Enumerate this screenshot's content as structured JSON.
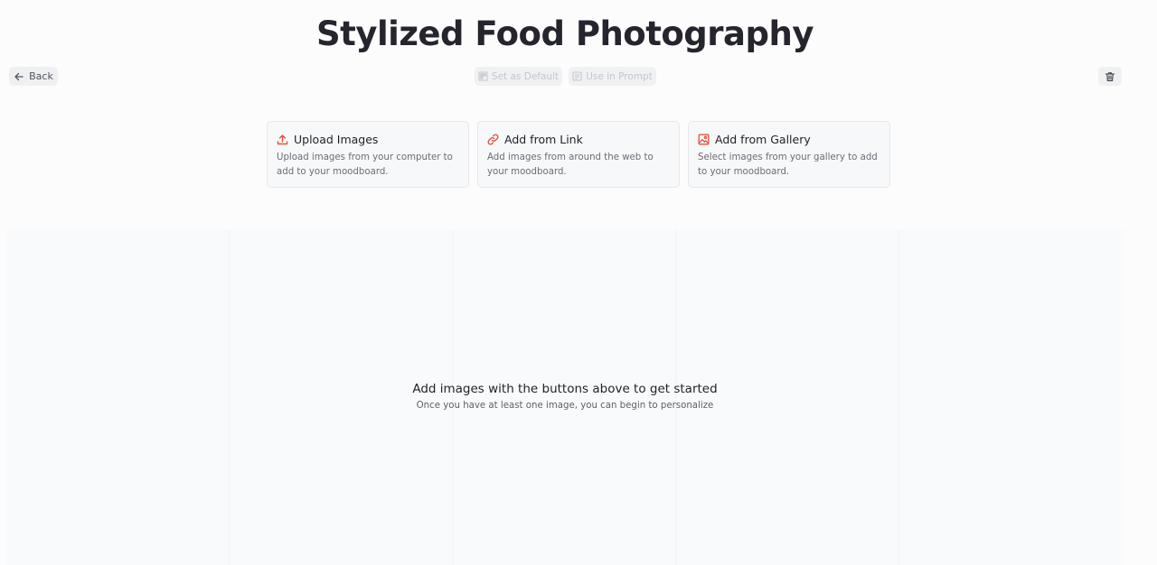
{
  "header": {
    "title": "Stylized Food Photography"
  },
  "toolbar": {
    "back_label": "Back",
    "set_default_label": "Set as Default",
    "use_in_prompt_label": "Use in Prompt"
  },
  "actions": [
    {
      "title": "Upload Images",
      "description": "Upload images from your computer to add to your moodboard.",
      "icon": "upload-icon"
    },
    {
      "title": "Add from Link",
      "description": "Add images from around the web to your moodboard.",
      "icon": "link-icon"
    },
    {
      "title": "Add from Gallery",
      "description": "Select images from your gallery to add to your moodboard.",
      "icon": "gallery-icon"
    }
  ],
  "empty_state": {
    "title": "Add images with the buttons above to get started",
    "subtitle": "Once you have at least one image, you can begin to personalize"
  },
  "colors": {
    "accent": "#e0533d",
    "background": "#fcfcfd",
    "card_background": "#f7f8f9"
  }
}
